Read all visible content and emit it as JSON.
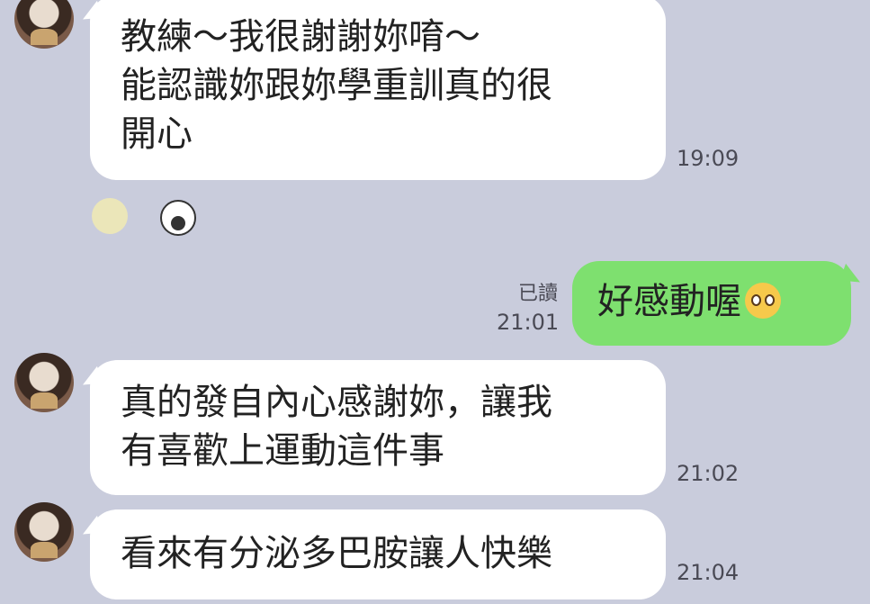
{
  "messages": [
    {
      "text_lines": [
        "教練～我很謝謝妳唷～",
        "能認識妳跟妳學重訓真的很",
        "開心"
      ],
      "time": "19:09"
    },
    {
      "text": "好感動喔",
      "read": "已讀",
      "time": "21:01"
    },
    {
      "text_lines": [
        "真的發自內心感謝妳，讓我",
        "有喜歡上運動這件事"
      ],
      "time": "21:02"
    },
    {
      "text": "看來有分泌多巴胺讓人快樂",
      "time": "21:04"
    }
  ],
  "icons": {
    "reaction_smile": "smiley-face-icon",
    "reaction_sticker": "sticker-face-icon",
    "emoji_pleading": "pleading-face-emoji"
  },
  "colors": {
    "background": "#c9ccdc",
    "incoming_bubble": "#ffffff",
    "outgoing_bubble": "#7ee06f"
  }
}
